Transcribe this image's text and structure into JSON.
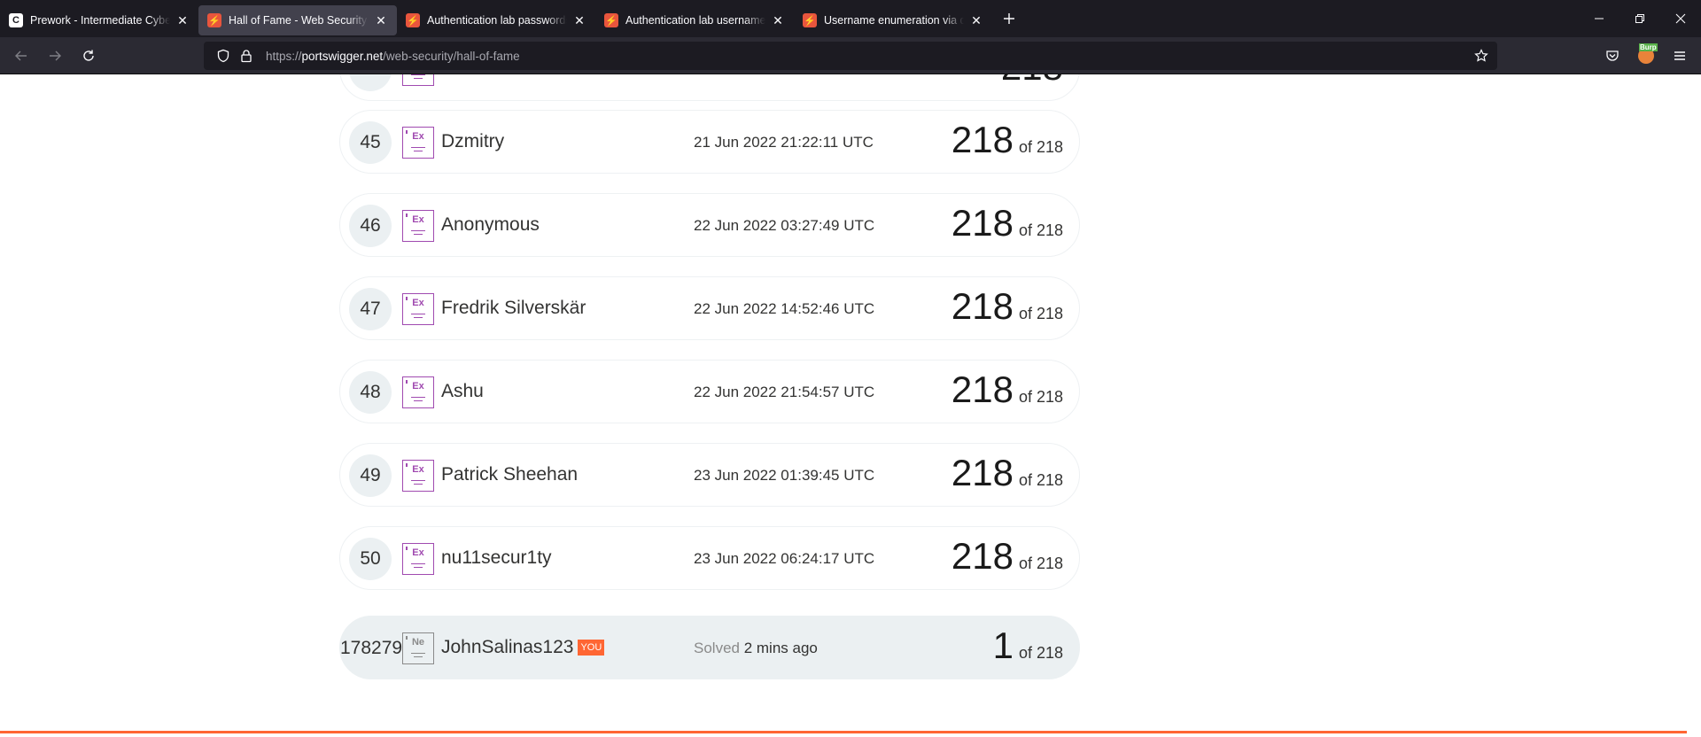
{
  "browser": {
    "tabs": [
      {
        "title": "Prework - Intermediate Cyberse",
        "favicon": "C",
        "favicon_style": "c",
        "active": false
      },
      {
        "title": "Hall of Fame - Web Security Ac",
        "favicon": "⚡",
        "favicon_style": "ps",
        "active": true
      },
      {
        "title": "Authentication lab passwords | W",
        "favicon": "⚡",
        "favicon_style": "ps",
        "active": false
      },
      {
        "title": "Authentication lab usernames | ",
        "favicon": "⚡",
        "favicon_style": "ps",
        "active": false
      },
      {
        "title": "Username enumeration via diffe",
        "favicon": "⚡",
        "favicon_style": "ps",
        "active": false
      }
    ],
    "url": {
      "prefix": "https://",
      "domain": "portswigger.net",
      "path": "/web-security/hall-of-fame"
    },
    "extension_label": "Burp"
  },
  "leaderboard": [
    {
      "rank": "45",
      "badge": "Ex",
      "name": "Dzmitry",
      "date": "21 Jun 2022 21:22:11 UTC",
      "score": "218",
      "total": "of 218"
    },
    {
      "rank": "46",
      "badge": "Ex",
      "name": "Anonymous",
      "date": "22 Jun 2022 03:27:49 UTC",
      "score": "218",
      "total": "of 218"
    },
    {
      "rank": "47",
      "badge": "Ex",
      "name": "Fredrik Silverskär",
      "date": "22 Jun 2022 14:52:46 UTC",
      "score": "218",
      "total": "of 218"
    },
    {
      "rank": "48",
      "badge": "Ex",
      "name": "Ashu",
      "date": "22 Jun 2022 21:54:57 UTC",
      "score": "218",
      "total": "of 218"
    },
    {
      "rank": "49",
      "badge": "Ex",
      "name": "Patrick Sheehan",
      "date": "23 Jun 2022 01:39:45 UTC",
      "score": "218",
      "total": "of 218"
    },
    {
      "rank": "50",
      "badge": "Ex",
      "name": "nu11secur1ty",
      "date": "23 Jun 2022 06:24:17 UTC",
      "score": "218",
      "total": "of 218"
    }
  ],
  "current_user": {
    "rank": "178279",
    "badge": "Ne",
    "name": "JohnSalinas123",
    "you_tag": "YOU",
    "solved_label": "Solved",
    "solved_time": "2 mins ago",
    "score": "1",
    "total": "of 218"
  },
  "colors": {
    "accent": "#ff6633",
    "expert_badge": "#a04ab0",
    "row_highlight": "#ebf0f2"
  }
}
